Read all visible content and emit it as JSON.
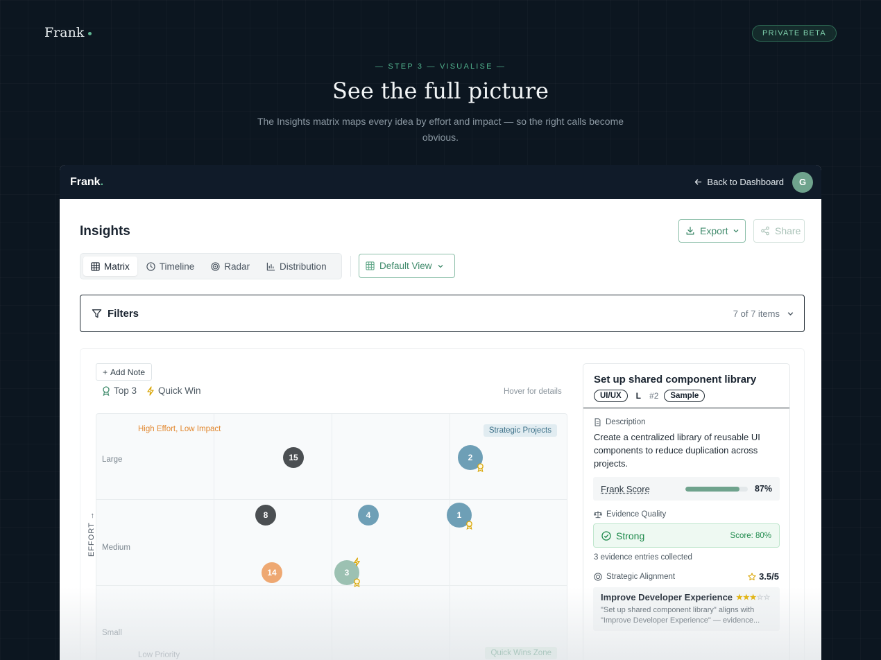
{
  "site": {
    "brand": "Frank",
    "beta_badge": "PRIVATE BETA",
    "eyebrow": "— STEP 3 — VISUALISE —",
    "title": "See the full picture",
    "subtitle": "The Insights matrix maps every idea by effort and impact — so the right calls become obvious."
  },
  "app": {
    "logo": "Frank",
    "logo_dot": ".",
    "back_label": "Back to Dashboard",
    "avatar_initial": "G",
    "page_title": "Insights",
    "export_label": "Export",
    "share_label": "Share",
    "tabs": [
      {
        "label": "Matrix",
        "icon": "grid-icon",
        "active": true
      },
      {
        "label": "Timeline",
        "icon": "clock-icon",
        "active": false
      },
      {
        "label": "Radar",
        "icon": "radar-icon",
        "active": false
      },
      {
        "label": "Distribution",
        "icon": "bar-chart-icon",
        "active": false
      }
    ],
    "view_select": "Default View",
    "filters_label": "Filters",
    "filters_count": "7 of 7 items"
  },
  "matrix": {
    "add_note": "Add Note",
    "legend": {
      "top3": "Top 3",
      "quick_win": "Quick Win"
    },
    "hover_hint": "Hover for details",
    "y_axis_title": "EFFORT →",
    "y_labels": {
      "large": "Large",
      "medium": "Medium",
      "small": "Small"
    },
    "quadrants": {
      "high_effort_low_impact": "High Effort, Low Impact",
      "strategic": "Strategic Projects",
      "low_priority": "Low Priority",
      "quick_wins": "Quick Wins Zone"
    },
    "items": [
      {
        "id": "15",
        "color": "#4b4f52",
        "effort": "Large",
        "top3": false,
        "quick_win": false
      },
      {
        "id": "2",
        "color": "#6e9fb6",
        "effort": "Large",
        "top3": true,
        "quick_win": false
      },
      {
        "id": "8",
        "color": "#4b4f52",
        "effort": "Medium",
        "top3": false,
        "quick_win": false
      },
      {
        "id": "4",
        "color": "#6e9fb6",
        "effort": "Medium",
        "top3": false,
        "quick_win": false
      },
      {
        "id": "1",
        "color": "#6e9fb6",
        "effort": "Medium",
        "top3": true,
        "quick_win": false
      },
      {
        "id": "14",
        "color": "#eea872",
        "effort": "Medium",
        "top3": false,
        "quick_win": false
      },
      {
        "id": "3",
        "color": "#9cc1b2",
        "effort": "Medium",
        "top3": true,
        "quick_win": true
      }
    ]
  },
  "detail": {
    "title": "Set up shared component library",
    "tag_category": "UI/UX",
    "tag_size": "L",
    "tag_rank": "#2",
    "tag_sample": "Sample",
    "description_label": "Description",
    "description": "Create a centralized library of reusable UI components to reduce duplication across projects.",
    "frank_score_label": "Frank Score",
    "frank_score_value": "87%",
    "frank_score_fraction": 0.87,
    "evidence_label": "Evidence Quality",
    "evidence_rating": "Strong",
    "evidence_score": "Score: 80%",
    "evidence_count": "3 evidence entries collected",
    "alignment_label": "Strategic Alignment",
    "alignment_score": "3.5/5",
    "goal_title": "Improve Developer Experience",
    "goal_text": "\"Set up shared component library\" aligns with \"Improve Developer Experience\" — evidence..."
  },
  "colors": {
    "accent": "#5fb592",
    "app_bar": "#101b29",
    "page_bg": "#0c1620",
    "evidence_green": "#1f8a4c",
    "warning_orange": "#e2872e"
  }
}
